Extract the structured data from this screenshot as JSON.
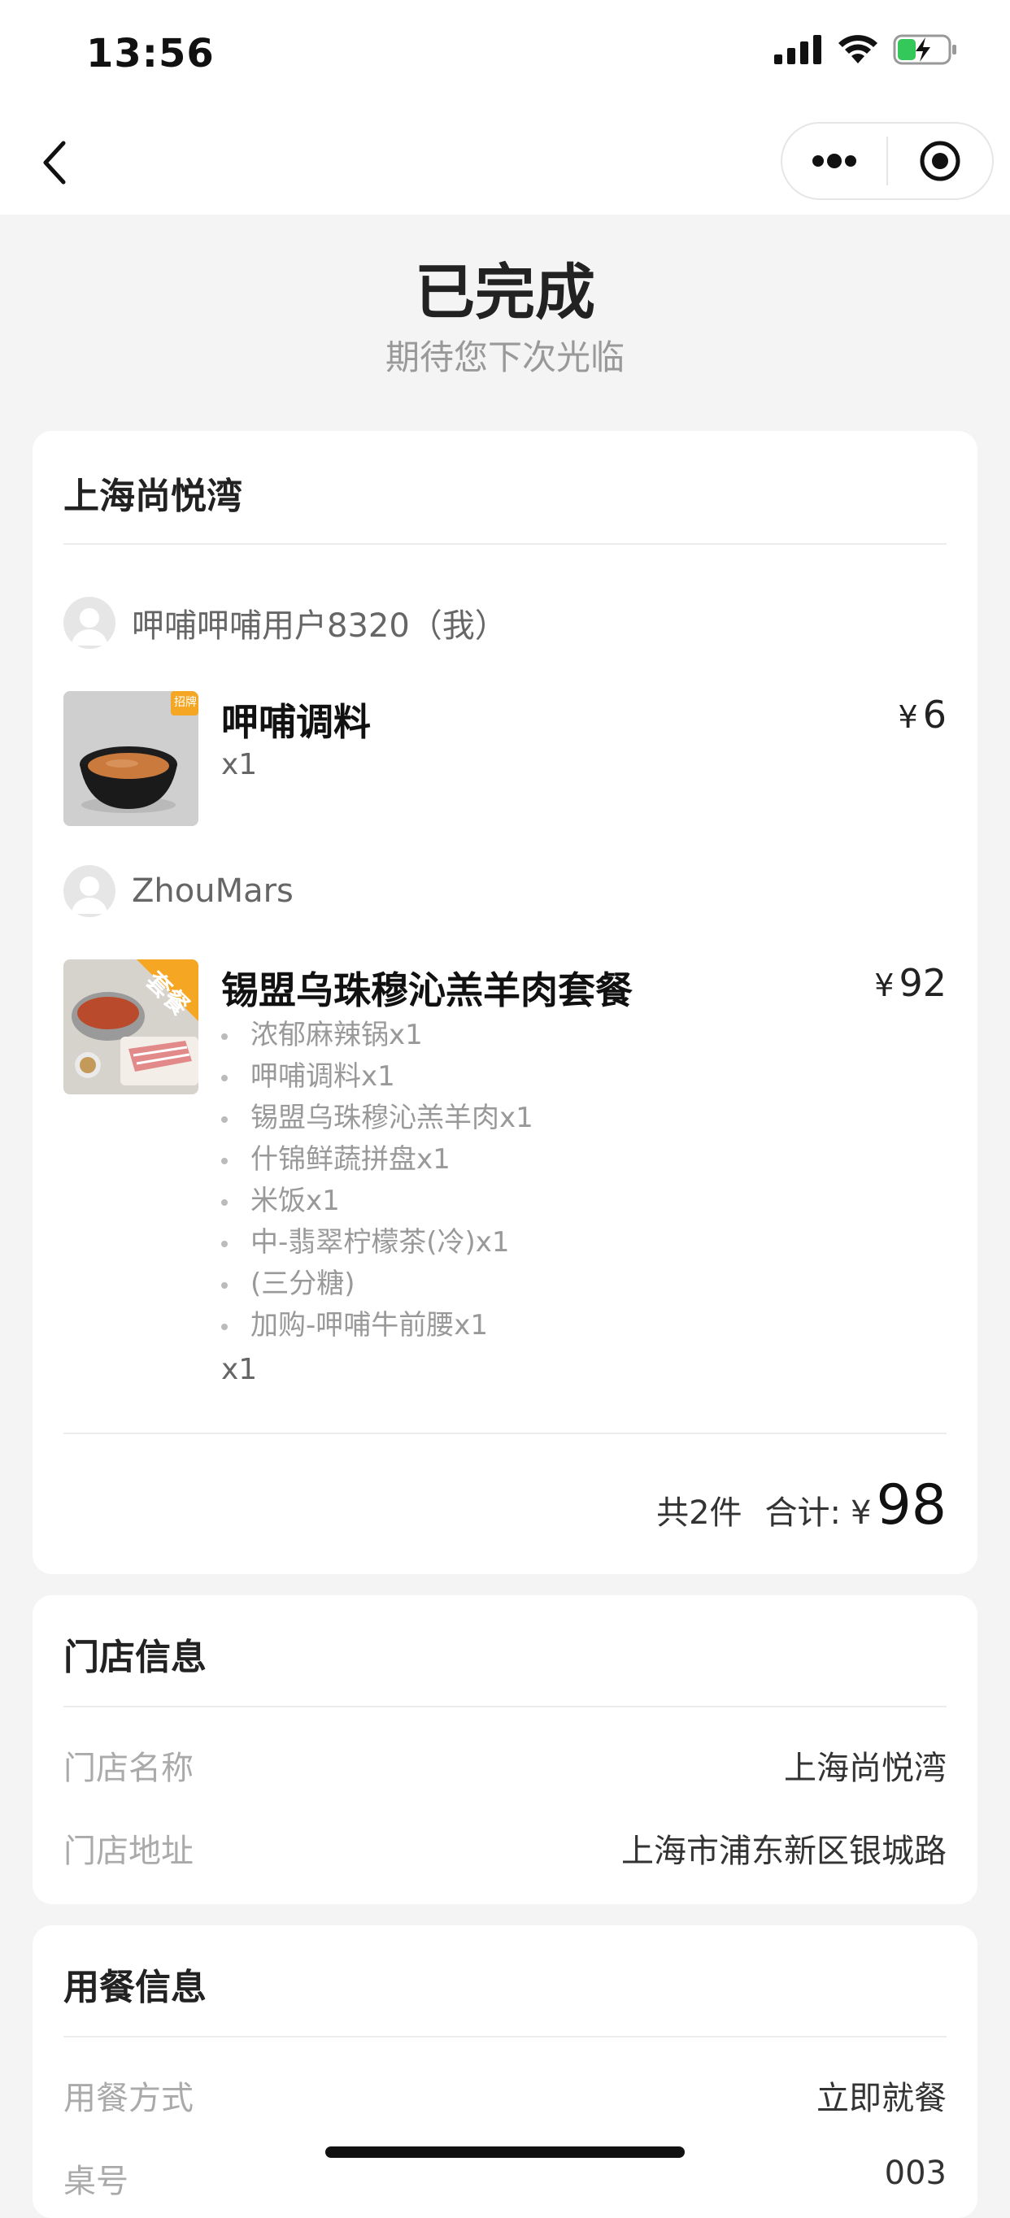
{
  "status_bar": {
    "time": "13:56"
  },
  "order": {
    "status_title": "已完成",
    "status_subtitle": "期待您下次光临"
  },
  "store_card": {
    "store_name": "上海尚悦湾",
    "groups": [
      {
        "user": "呷哺呷哺用户8320（我）",
        "items": [
          {
            "name": "呷哺调料",
            "qty": "x1",
            "price": "6",
            "badge": "招牌",
            "sub_items": []
          }
        ]
      },
      {
        "user": "ZhouMars",
        "items": [
          {
            "name": "锡盟乌珠穆沁羔羊肉套餐",
            "qty": "x1",
            "price": "92",
            "badge": "套餐",
            "sub_items": [
              "浓郁麻辣锅x1",
              "呷哺调料x1",
              "锡盟乌珠穆沁羔羊肉x1",
              "什锦鲜蔬拼盘x1",
              "米饭x1",
              "中-翡翠柠檬茶(冷)x1",
              "(三分糖)",
              "加购-呷哺牛前腰x1"
            ]
          }
        ]
      }
    ],
    "currency": "¥",
    "total_count": "共2件",
    "total_label": "合计:",
    "total_amount": "98"
  },
  "store_info": {
    "title": "门店信息",
    "rows": [
      {
        "label": "门店名称",
        "value": "上海尚悦湾"
      },
      {
        "label": "门店地址",
        "value": "上海市浦东新区银城路"
      }
    ]
  },
  "dining_info": {
    "title": "用餐信息",
    "rows": [
      {
        "label": "用餐方式",
        "value": "立即就餐"
      },
      {
        "label": "桌号",
        "value": "003"
      }
    ]
  },
  "colors": {
    "accent": "#f5a623",
    "background": "#f4f4f4"
  }
}
